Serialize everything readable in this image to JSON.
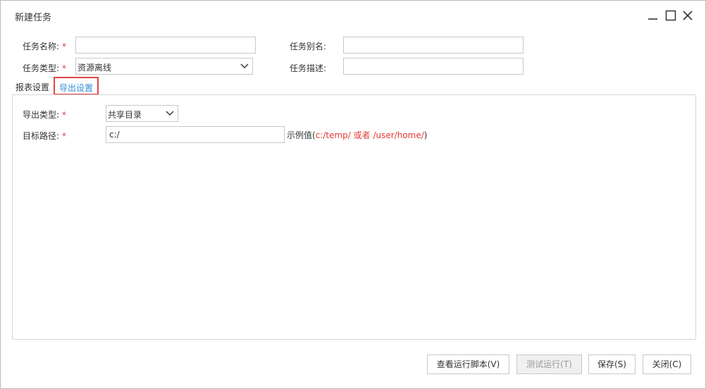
{
  "window": {
    "title": "新建任务",
    "controls": {
      "minimize": "minimize-icon",
      "maximize": "maximize-icon",
      "close": "close-icon"
    }
  },
  "form": {
    "task_name": {
      "label": "任务名称:",
      "required_mark": "*",
      "value": ""
    },
    "task_alias": {
      "label": "任务别名:",
      "value": ""
    },
    "task_type": {
      "label": "任务类型:",
      "required_mark": "*",
      "value": "资源离线"
    },
    "task_desc": {
      "label": "任务描述:",
      "value": ""
    }
  },
  "tabs": {
    "report": "报表设置",
    "export": "导出设置",
    "active": "export"
  },
  "export": {
    "export_type": {
      "label": "导出类型:",
      "required_mark": "*",
      "value": "共享目录"
    },
    "target_path": {
      "label": "目标路径:",
      "required_mark": "*",
      "value": "c:/"
    },
    "hint_prefix": "示例值(",
    "hint_example": "c:/temp/ 或者 /user/home/",
    "hint_suffix": ")"
  },
  "buttons": {
    "view_script": "查看运行脚本(V)",
    "test_run": "测试运行(T)",
    "save": "保存(S)",
    "close": "关闭(C)"
  },
  "colors": {
    "required": "#e53935",
    "tab_active_text": "#2f8fd8",
    "tab_highlight_border": "#e2454b",
    "border": "#c8c8c8"
  }
}
